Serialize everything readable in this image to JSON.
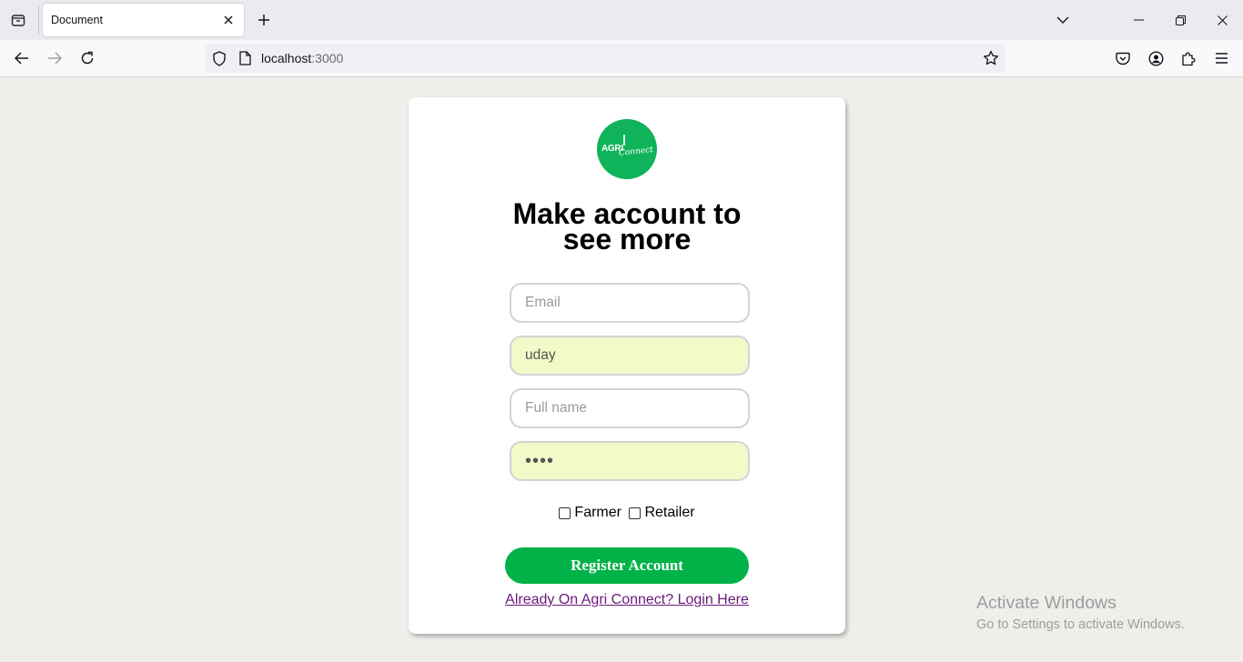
{
  "browser": {
    "tab_title": "Document",
    "url_host": "localhost",
    "url_port": ":3000"
  },
  "logo": {
    "agri": "AGRI",
    "connect": "Connect"
  },
  "form": {
    "heading_line1": "Make account to",
    "heading_line2": "see more",
    "email_placeholder": "Email",
    "username_value": "uday",
    "fullname_placeholder": "Full name",
    "password_value": "••••",
    "role_farmer": "Farmer",
    "role_retailer": "Retailer",
    "register_label": "Register Account",
    "login_link": "Already On Agri Connect? Login Here"
  },
  "watermark": {
    "title": "Activate Windows",
    "subtitle": "Go to Settings to activate Windows."
  },
  "colors": {
    "brand_green": "#00b248",
    "autofill_bg": "#f3f9c8",
    "link_purple": "#6b1a7c"
  }
}
